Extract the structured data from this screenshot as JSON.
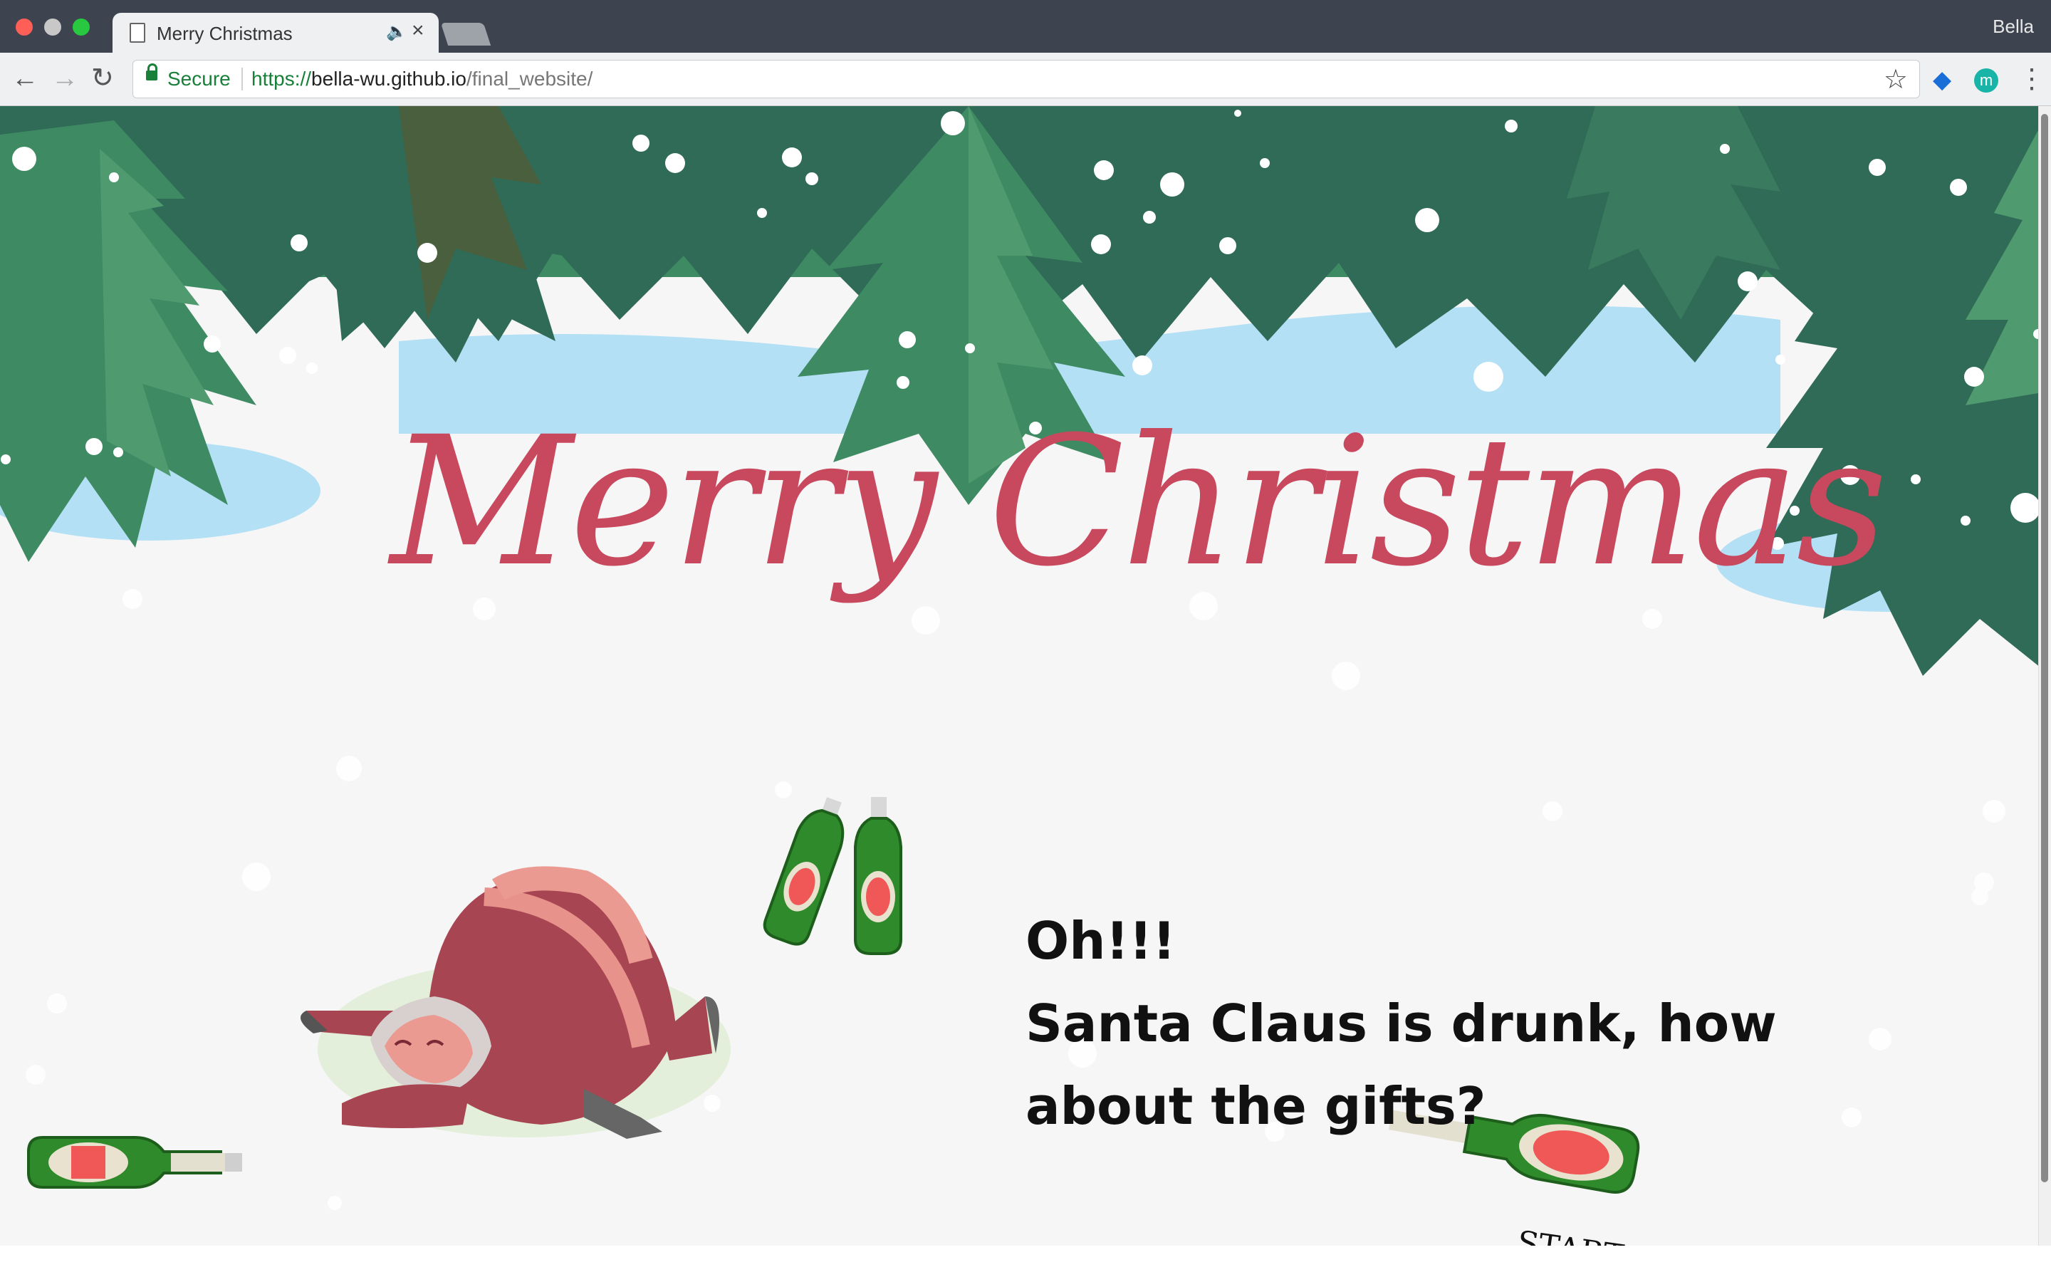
{
  "browser": {
    "tab_title": "Merry Christmas",
    "profile_name": "Bella",
    "secure_label": "Secure",
    "url": {
      "scheme": "https://",
      "host": "bella-wu.github.io",
      "path": "/final_website/"
    }
  },
  "page": {
    "title": "Merry Christmas",
    "exclaim": "Oh!!!",
    "message": "Santa Claus is drunk, how about the gifts?",
    "start_label": "START"
  },
  "colors": {
    "title": "#c8485e",
    "pine_dark": "#2f6b56",
    "pine_mid": "#3d8a63",
    "pine_light": "#4f9a6f",
    "ice": "#b3e0f5",
    "santa_red": "#a84552",
    "bottle_green": "#2e8a2a"
  }
}
